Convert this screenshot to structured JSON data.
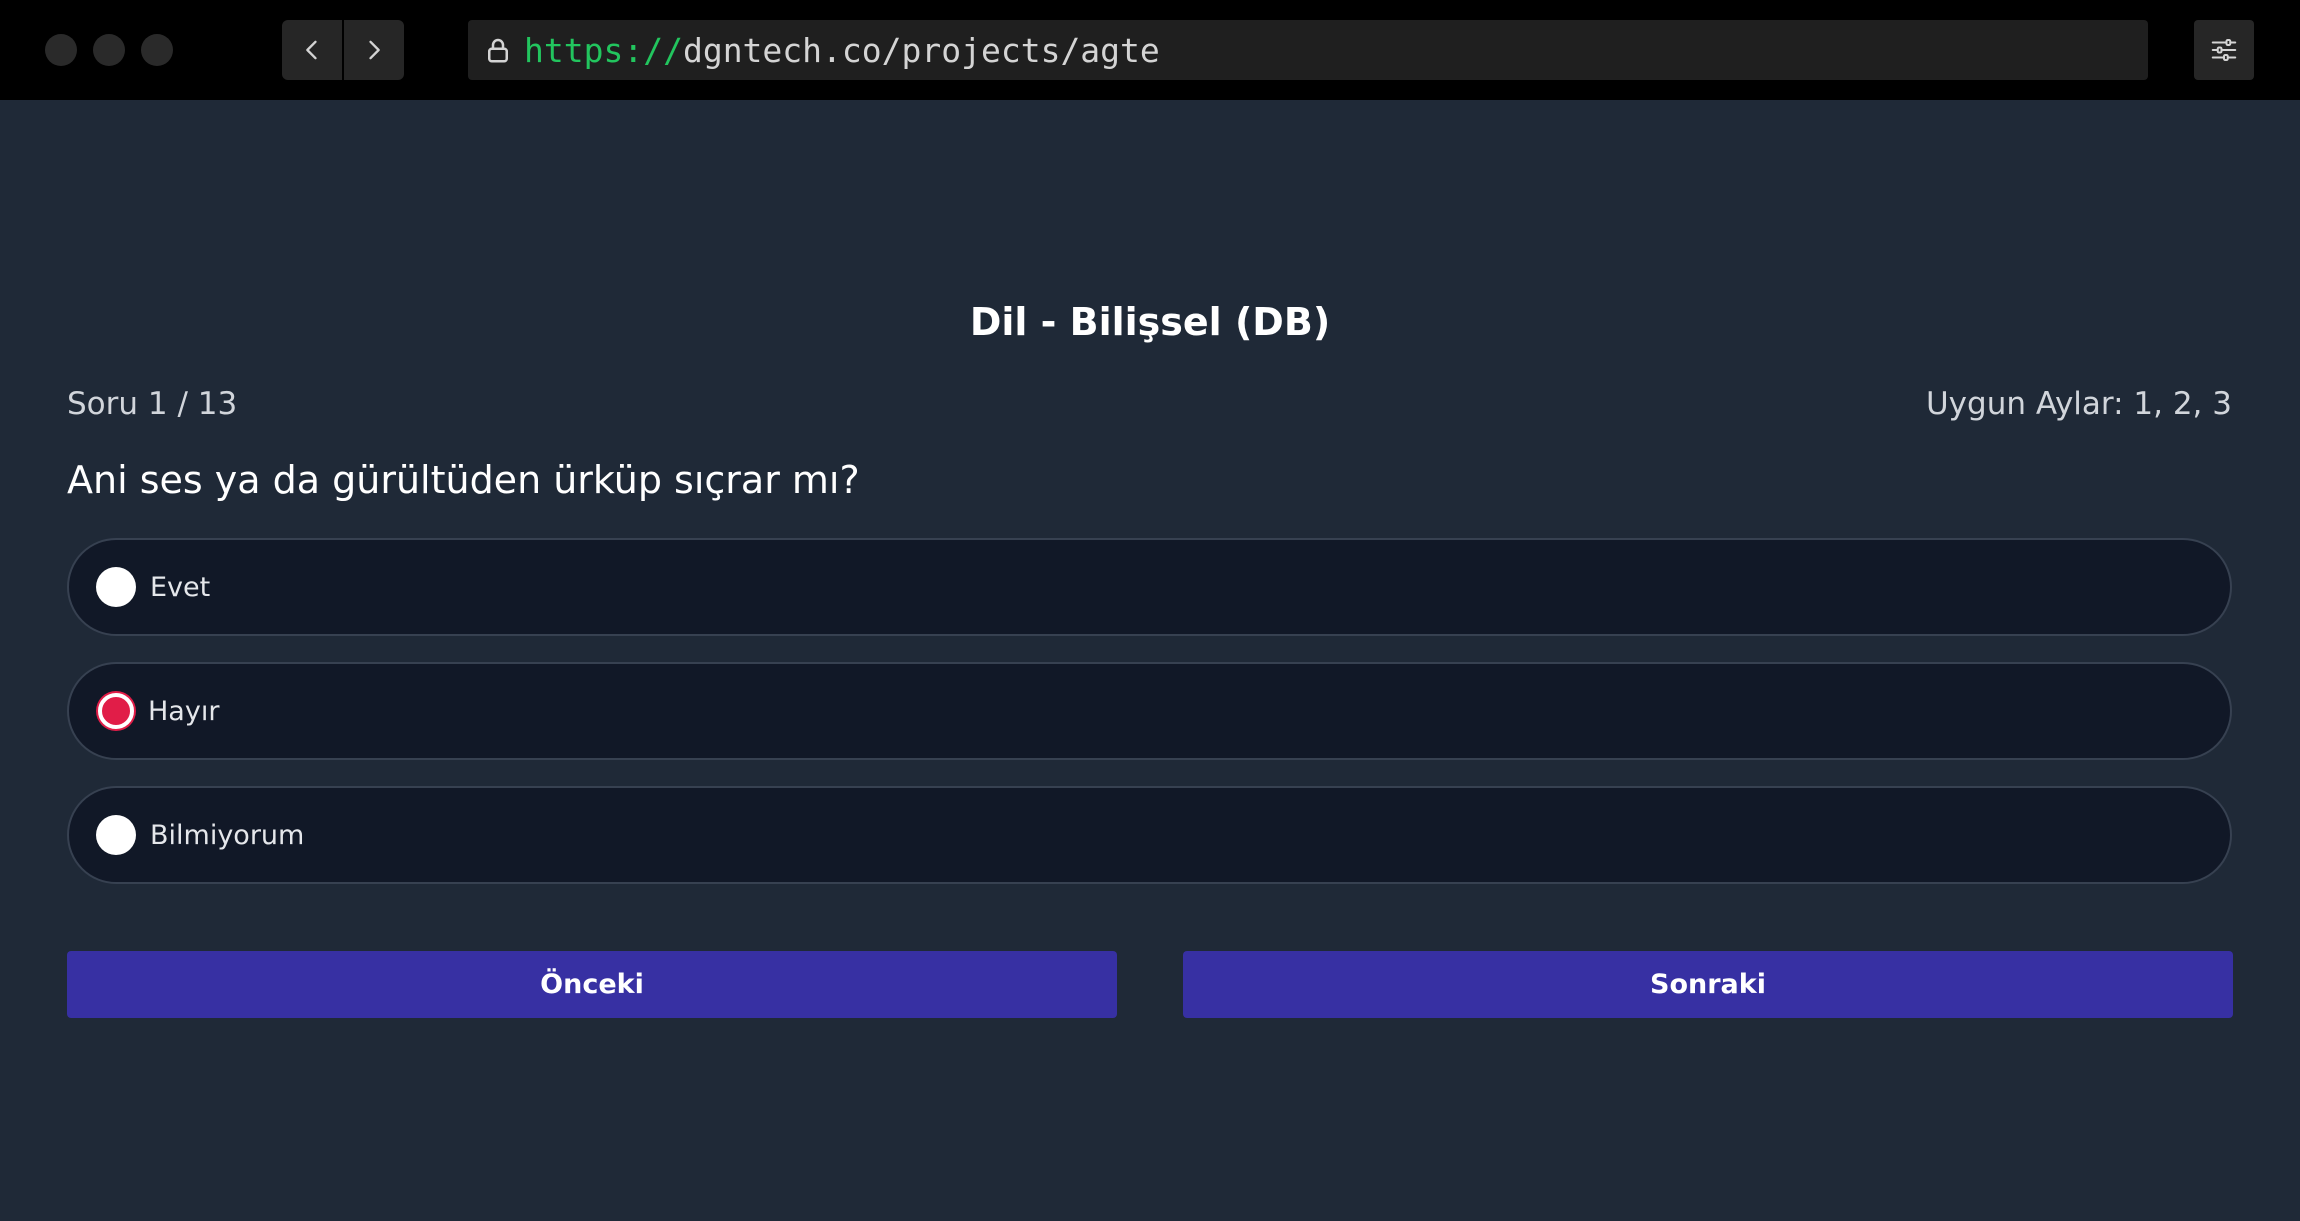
{
  "browser": {
    "url_scheme": "https://",
    "url_rest": "dgntech.co/projects/agte",
    "icons": [
      "back-icon",
      "forward-icon",
      "lock-icon",
      "settings-sliders-icon"
    ]
  },
  "page": {
    "title": "Dil - Bilişsel (DB)",
    "counter": "Soru 1 / 13",
    "months": "Uygun Aylar: 1, 2, 3",
    "question": "Ani ses ya da gürültüden ürküp sıçrar mı?",
    "options": [
      {
        "label": "Evet",
        "selected": false
      },
      {
        "label": "Hayır",
        "selected": true
      },
      {
        "label": "Bilmiyorum",
        "selected": false
      }
    ],
    "prev_label": "Önceki",
    "next_label": "Sonraki"
  },
  "colors": {
    "background": "#1f2937",
    "option_bg": "#111827",
    "button": "#3730a3",
    "selected_radio": "#e11d48",
    "url_scheme": "#22c55e"
  }
}
